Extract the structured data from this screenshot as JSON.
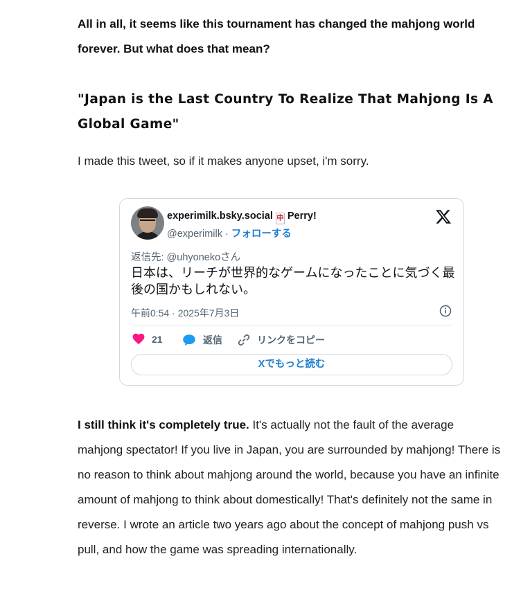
{
  "article": {
    "lead": "All in all, it seems like this tournament has changed the mahjong world forever. But what does that mean?",
    "heading": "\"Japan is the Last Country To Realize That Mahjong Is A Global Game\"",
    "intro": "I made this tweet, so if it makes anyone upset, i'm sorry.",
    "body_bold": " I still think it's completely true.",
    "body_text": " It's actually not the fault of the average mahjong spectator! If you live in Japan, you are surrounded by mahjong! There is no reason to think about mahjong around the world, because you have an infinite amount of mahjong to think about domestically! That's definitely not the same in reverse. I wrote an article two years ago about the concept of mahjong push vs pull, and how the game was spreading internationally."
  },
  "tweet": {
    "author_name": "experimilk.bsky.social",
    "name_tile_char": "中",
    "author_name_suffix": "Perry!",
    "handle": "@experimilk",
    "separator": " · ",
    "follow_label": "フォローする",
    "reply_to": "返信先: @uhyonekoさん",
    "text": "日本は、リーチが世界的なゲームになったことに気づく最後の国かもしれない。",
    "timestamp": "午前0:54 · 2025年7月3日",
    "like_count": "21",
    "reply_label": "返信",
    "copy_link_label": "リンクをコピー",
    "read_more_label": "Xでもっと読む",
    "icons": {
      "logo": "x-logo-icon",
      "info": "info-icon",
      "like": "heart-icon",
      "reply": "speech-bubble-icon",
      "copy": "link-icon"
    },
    "colors": {
      "like": "#f91880",
      "reply": "#1d9bf0",
      "link": "#1d7fd1",
      "muted": "#536471"
    }
  }
}
